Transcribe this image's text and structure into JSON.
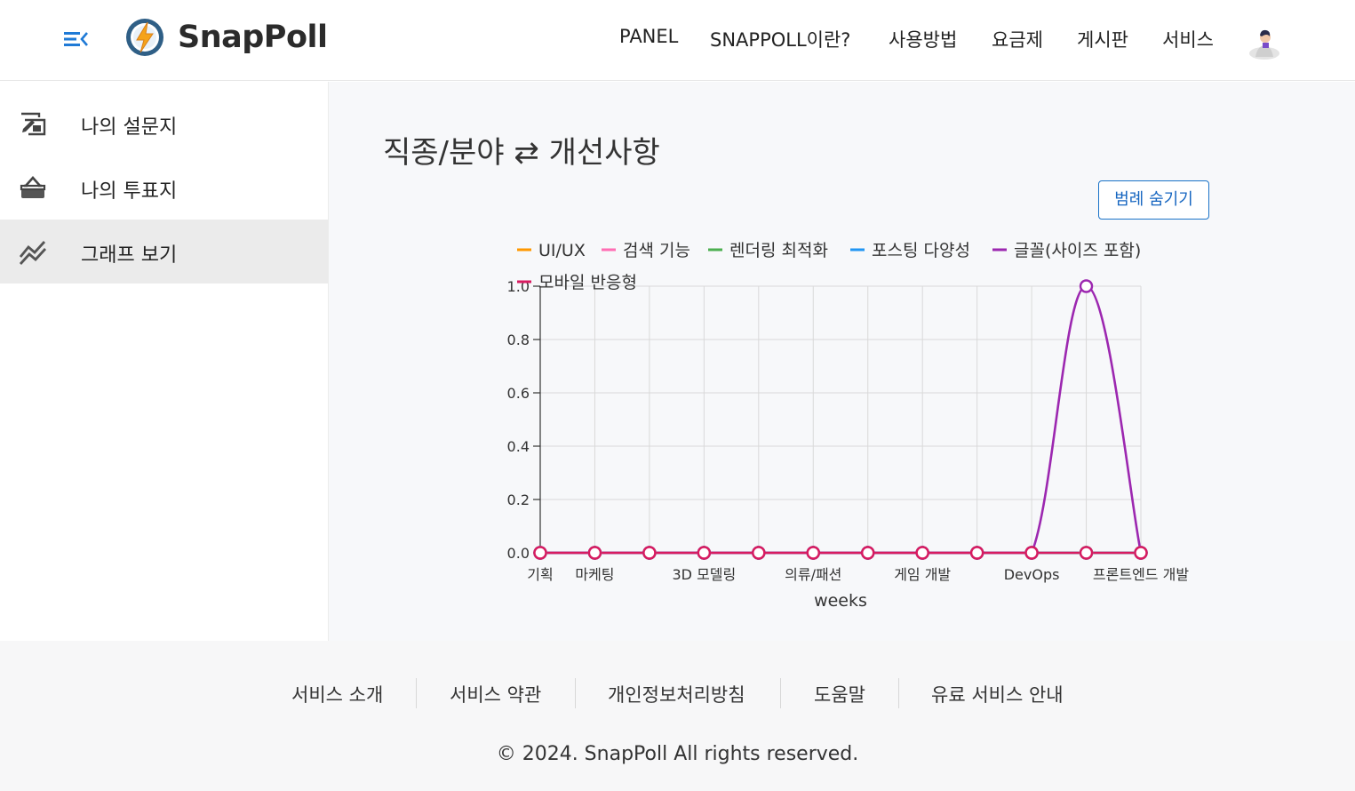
{
  "header": {
    "brand": "SnapPoll",
    "nav": [
      "PANEL",
      "SNAPPOLL이란?",
      "사용방법",
      "요금제",
      "게시판",
      "서비스"
    ]
  },
  "sidebar": {
    "items": [
      {
        "label": "나의 설문지",
        "icon": "survey-edit-icon"
      },
      {
        "label": "나의 투표지",
        "icon": "vote-box-icon"
      },
      {
        "label": "그래프 보기",
        "icon": "chart-trend-icon",
        "active": true
      }
    ]
  },
  "main": {
    "title": "직종/분야 ⇄ 개선사항",
    "legend_button": "범례 숨기기"
  },
  "chart_data": {
    "type": "line",
    "categories": [
      "기획",
      "마케팅",
      "",
      "3D 모델링",
      "",
      "의류/패션",
      "",
      "게임 개발",
      "",
      "DevOps",
      "",
      "프론트엔드 개발"
    ],
    "xlabel": "weeks",
    "ylabel": "",
    "ylim": [
      0,
      1.0
    ],
    "yticks": [
      "0.0",
      "0.2",
      "0.4",
      "0.6",
      "0.8",
      "1.0"
    ],
    "grid": true,
    "legend_position": "top",
    "series": [
      {
        "name": "UI/UX",
        "color": "#ff9800",
        "values": [
          0,
          0,
          0,
          0,
          0,
          0,
          0,
          0,
          0,
          0,
          0,
          0
        ]
      },
      {
        "name": "검색 기능",
        "color": "#ff6eb4",
        "values": [
          0,
          0,
          0,
          0,
          0,
          0,
          0,
          0,
          0,
          0,
          0,
          0
        ]
      },
      {
        "name": "렌더링 최적화",
        "color": "#4caf50",
        "values": [
          0,
          0,
          0,
          0,
          0,
          0,
          0,
          0,
          0,
          0,
          0,
          0
        ]
      },
      {
        "name": "포스팅 다양성",
        "color": "#2196f3",
        "values": [
          0,
          0,
          0,
          0,
          0,
          0,
          0,
          0,
          0,
          0,
          0,
          0
        ]
      },
      {
        "name": "글꼴(사이즈 포함)",
        "color": "#9c27b0",
        "values": [
          0,
          0,
          0,
          0,
          0,
          0,
          0,
          0,
          0,
          0,
          1,
          0
        ]
      },
      {
        "name": "모바일 반응형",
        "color": "#d81b60",
        "values": [
          0,
          0,
          0,
          0,
          0,
          0,
          0,
          0,
          0,
          0,
          0,
          0
        ]
      }
    ]
  },
  "footer": {
    "links": [
      "서비스 소개",
      "서비스 약관",
      "개인정보처리방침",
      "도움말",
      "유료 서비스 안내"
    ],
    "copyright": "© 2024. SnapPoll All rights reserved."
  }
}
